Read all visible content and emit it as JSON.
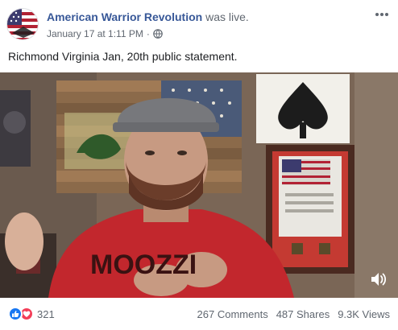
{
  "post": {
    "author": "American Warrior Revolution",
    "action": "was live.",
    "timestamp": "January 17 at 1:11 PM",
    "separator": "·",
    "privacy_icon": "globe-icon",
    "more_icon": "more-options-icon",
    "text": "Richmond Virginia Jan, 20th public statement."
  },
  "video": {
    "shirt_text": "MOOZZI",
    "volume_icon": "speaker-icon"
  },
  "footer": {
    "reaction_icons": [
      "like-icon",
      "love-icon"
    ],
    "reaction_count": "321",
    "comments": "267 Comments",
    "shares": "487 Shares",
    "views": "9.3K Views"
  },
  "colors": {
    "link": "#385898",
    "meta": "#606770",
    "like": "#1877f2",
    "love": "#f33e58",
    "shirt": "#c2272d"
  }
}
